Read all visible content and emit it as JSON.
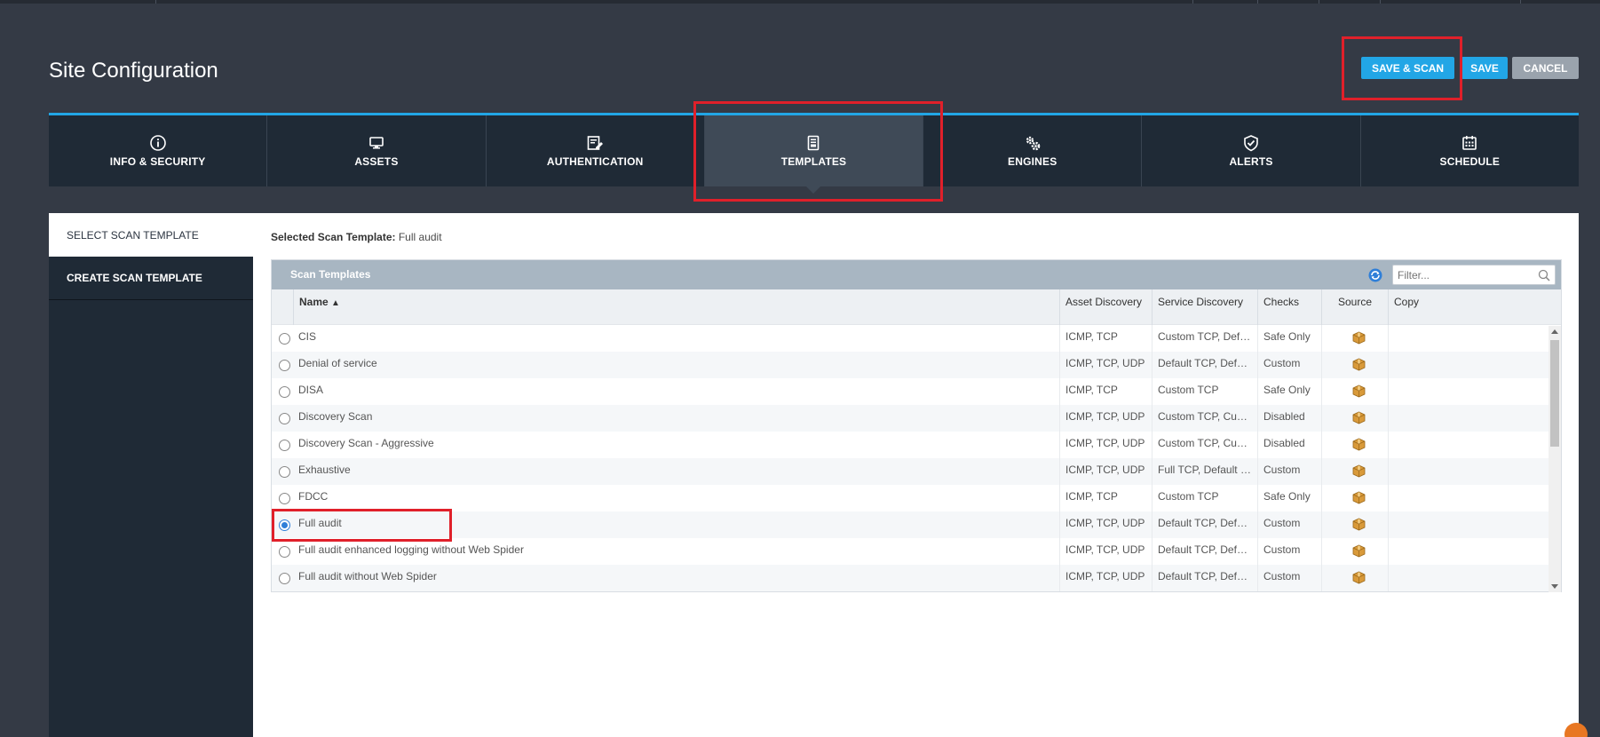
{
  "page": {
    "title": "Site Configuration"
  },
  "actions": {
    "save_scan": "SAVE & SCAN",
    "save": "SAVE",
    "cancel": "CANCEL"
  },
  "tabs": [
    {
      "label": "INFO & SECURITY",
      "icon": "info-icon",
      "active": false
    },
    {
      "label": "ASSETS",
      "icon": "monitor-icon",
      "active": false
    },
    {
      "label": "AUTHENTICATION",
      "icon": "edit-form-icon",
      "active": false
    },
    {
      "label": "TEMPLATES",
      "icon": "template-icon",
      "active": true
    },
    {
      "label": "ENGINES",
      "icon": "gears-icon",
      "active": false
    },
    {
      "label": "ALERTS",
      "icon": "shield-check-icon",
      "active": false
    },
    {
      "label": "SCHEDULE",
      "icon": "calendar-icon",
      "active": false
    }
  ],
  "left_nav": [
    {
      "label": "SELECT SCAN TEMPLATE",
      "active": true
    },
    {
      "label": "CREATE SCAN TEMPLATE",
      "active": false
    }
  ],
  "selected": {
    "label": "Selected Scan Template:",
    "value": "Full audit"
  },
  "grid": {
    "title": "Scan Templates",
    "filter_placeholder": "Filter...",
    "columns": [
      "Name",
      "Asset Discovery",
      "Service Discovery",
      "Checks",
      "Source",
      "Copy"
    ],
    "sort_indicator": "▲",
    "rows": [
      {
        "name": "CIS",
        "asset": "ICMP, TCP",
        "service": "Custom TCP, Default UDP",
        "checks": "Safe Only",
        "selected": false
      },
      {
        "name": "Denial of service",
        "asset": "ICMP, TCP, UDP",
        "service": "Default TCP, Default UDP",
        "checks": "Custom",
        "selected": false
      },
      {
        "name": "DISA",
        "asset": "ICMP, TCP",
        "service": "Custom TCP",
        "checks": "Safe Only",
        "selected": false
      },
      {
        "name": "Discovery Scan",
        "asset": "ICMP, TCP, UDP",
        "service": "Custom TCP, Custom UDP",
        "checks": "Disabled",
        "selected": false
      },
      {
        "name": "Discovery Scan - Aggressive",
        "asset": "ICMP, TCP, UDP",
        "service": "Custom TCP, Custom UDP",
        "checks": "Disabled",
        "selected": false
      },
      {
        "name": "Exhaustive",
        "asset": "ICMP, TCP, UDP",
        "service": "Full TCP, Default UDP",
        "checks": "Custom",
        "selected": false
      },
      {
        "name": "FDCC",
        "asset": "ICMP, TCP",
        "service": "Custom TCP",
        "checks": "Safe Only",
        "selected": false
      },
      {
        "name": "Full audit",
        "asset": "ICMP, TCP, UDP",
        "service": "Default TCP, Default UDP",
        "checks": "Custom",
        "selected": true
      },
      {
        "name": "Full audit enhanced logging without Web Spider",
        "asset": "ICMP, TCP, UDP",
        "service": "Default TCP, Default UDP",
        "checks": "Custom",
        "selected": false
      },
      {
        "name": "Full audit without Web Spider",
        "asset": "ICMP, TCP, UDP",
        "service": "Default TCP, Default UDP",
        "checks": "Custom",
        "selected": false
      }
    ]
  },
  "colors": {
    "accent": "#22a6e6",
    "annotation": "#e0202a",
    "nav_bg": "#1f2a36",
    "page_bg": "#343a45"
  }
}
